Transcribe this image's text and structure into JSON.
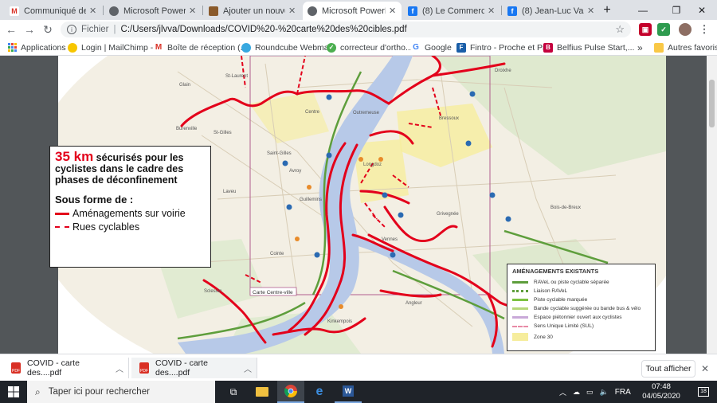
{
  "tabs": [
    {
      "label": "Communiqué de pre",
      "icon": "gmail-icon",
      "color": "#d93025",
      "glyph": "M"
    },
    {
      "label": "Microsoft PowerPoin",
      "icon": "web-icon",
      "color": "#5f6368",
      "glyph": ""
    },
    {
      "label": "Ajouter un nouvel ar",
      "icon": "site-icon",
      "color": "#8a5a2b",
      "glyph": ""
    },
    {
      "label": "Microsoft PowerPoin",
      "icon": "web-icon",
      "color": "#5f6368",
      "glyph": ""
    },
    {
      "label": "(8) Le Commerce Lié",
      "icon": "facebook-icon",
      "color": "#1877f2",
      "glyph": "f"
    },
    {
      "label": "(8) Jean-Luc Vasseur",
      "icon": "facebook-icon",
      "color": "#1877f2",
      "glyph": "f"
    }
  ],
  "new_tab": "+",
  "address": {
    "scheme": "Fichier",
    "separator": "|",
    "path": "C:/Users/jlvva/Downloads/COVID%20-%20carte%20des%20cibles.pdf"
  },
  "bookmarks": [
    {
      "label": "Applications",
      "icon": "apps-icon",
      "color": "#4285f4",
      "glyph": ""
    },
    {
      "label": "Login | MailChimp -...",
      "icon": "mailchimp-icon",
      "color": "#f7c600",
      "glyph": ""
    },
    {
      "label": "Boîte de réception (...",
      "icon": "gmail-icon",
      "color": "#d93025",
      "glyph": "M"
    },
    {
      "label": "Roundcube Webma...",
      "icon": "roundcube-icon",
      "color": "#37a8e0",
      "glyph": ""
    },
    {
      "label": "correcteur d'ortho...",
      "icon": "check-icon",
      "color": "#4caf50",
      "glyph": ""
    },
    {
      "label": "Google",
      "icon": "google-icon",
      "color": "#4285f4",
      "glyph": "G"
    },
    {
      "label": "Fintro - Proche et Pro",
      "icon": "fintro-icon",
      "color": "#1a5ea8",
      "glyph": "F"
    },
    {
      "label": "Belfius Pulse Start,...",
      "icon": "belfius-icon",
      "color": "#c4003d",
      "glyph": "B"
    }
  ],
  "bookmarks_more": "»",
  "other_bookmarks": "Autres favoris",
  "callout": {
    "km": "35 km",
    "line1_rest": " sécurisés pour les",
    "line2": "cyclistes dans le cadre des",
    "line3": "phases de déconfinement",
    "forme": "Sous forme de :",
    "legend_solid": "Aménagements sur voirie",
    "legend_dashed": "Rues cyclables",
    "red": "#e3001b"
  },
  "map": {
    "labels": [
      "Glain",
      "St-Laurent",
      "Burenville",
      "St-Gilles",
      "Centre",
      "Outremeuse",
      "Bressoux",
      "Saint-Gilles",
      "Avroy",
      "Longdoz",
      "Laveu",
      "Guillemins",
      "Vennes",
      "Grivegnée",
      "Bois-de-Breux",
      "Droixhe",
      "Sclessin",
      "Kinkempois",
      "Angleur",
      "Cointe"
    ],
    "centre_box": "Carte Centre-ville"
  },
  "legend": {
    "title": "AMÉNAGEMENTS EXISTANTS",
    "items": [
      {
        "label": "RAVeL ou piste cyclable séparée",
        "color": "#5e9e3c",
        "style": "solid"
      },
      {
        "label": "Liaison RAVeL",
        "color": "#5e9e3c",
        "style": "dotted"
      },
      {
        "label": "Piste cyclable marquée",
        "color": "#7cc242",
        "style": "solid"
      },
      {
        "label": "Bande cyclable suggérée ou bande bus & vélo",
        "color": "#b6d77a",
        "style": "solid"
      },
      {
        "label": "Espace piétonnier ouvert aux cyclistes",
        "color": "#c9a9d8",
        "style": "solid"
      },
      {
        "label": "Sens Unique Limité (SUL)",
        "color": "#e88aa6",
        "style": "dashed"
      },
      {
        "label": "Zone 30",
        "color": "#f6ed9d",
        "style": "area"
      }
    ]
  },
  "downloads": [
    {
      "label": "COVID - carte des....pdf"
    },
    {
      "label": "COVID - carte des....pdf"
    }
  ],
  "downloads_show_all": "Tout afficher",
  "taskbar": {
    "search_placeholder": "Taper ici pour rechercher",
    "lang": "FRA",
    "time": "07:48",
    "date": "04/05/2020",
    "notifications": "18"
  }
}
